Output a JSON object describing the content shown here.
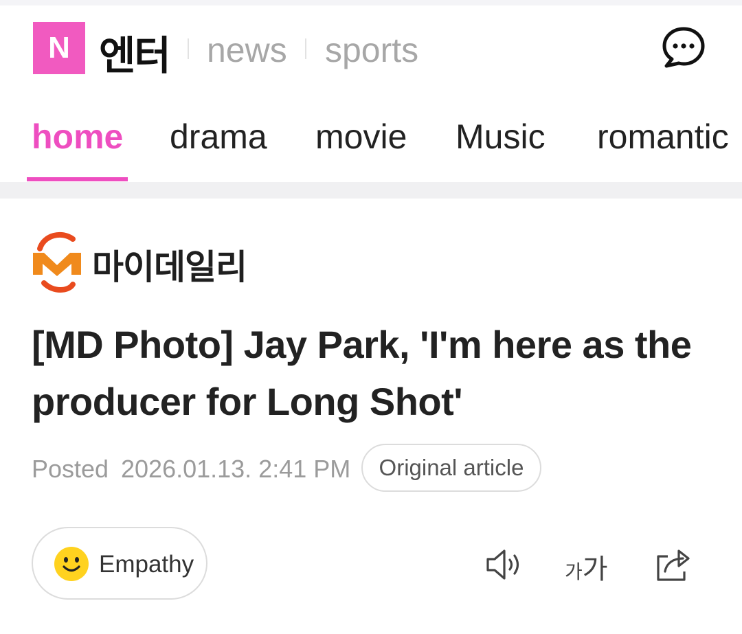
{
  "header": {
    "logo_letter": "N",
    "brand": "엔터",
    "links": [
      "news",
      "sports"
    ]
  },
  "nav": {
    "tabs": [
      "home",
      "drama",
      "movie",
      "Music",
      "romantic"
    ],
    "active": "home"
  },
  "article": {
    "source": "마이데일리",
    "title": "[MD Photo] Jay Park, 'I'm here as the producer for Long Shot'",
    "posted_label": "Posted",
    "posted_date": "2026.01.13. 2:41 PM",
    "original_label": "Original article"
  },
  "actions": {
    "empathy_label": "Empathy",
    "font_small": "가",
    "font_large": "가"
  },
  "colors": {
    "accent": "#ee4ec0",
    "logo_bg": "#f15ac0",
    "emoji": "#ffd21f"
  },
  "icons": [
    "chat-bubble-icon",
    "smile-emoji-icon",
    "speaker-icon",
    "font-size-icon",
    "share-icon"
  ]
}
